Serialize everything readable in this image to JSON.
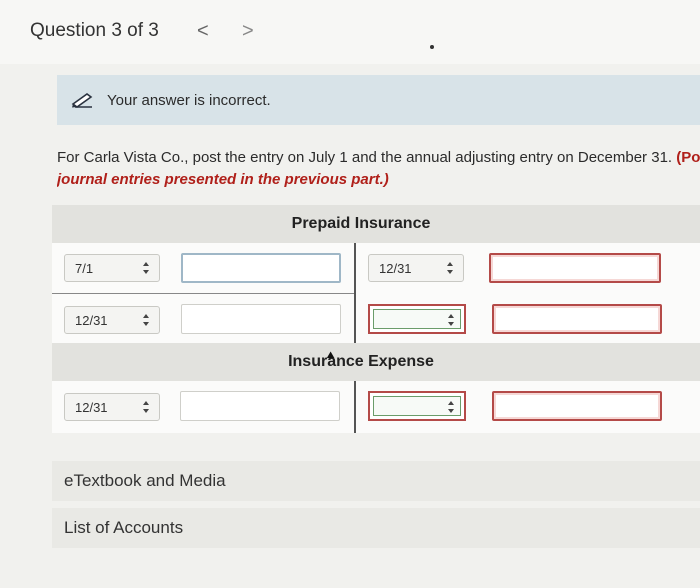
{
  "header": {
    "question": "Question 3 of 3",
    "prev": "<",
    "next": ">"
  },
  "banner": {
    "icon": "pencil-icon",
    "message": "Your answer is incorrect."
  },
  "prompt": {
    "text": "For Carla Vista Co., post the entry on July 1 and the annual adjusting entry on December 31.",
    "red_bold": "(Post e",
    "red_italic": "journal entries presented in the previous part.)"
  },
  "ledgers": {
    "prepaid": {
      "title": "Prepaid Insurance",
      "row1_left_date": "7/1",
      "row1_right_date": "12/31",
      "row2_left_date": "12/31"
    },
    "expense": {
      "title": "Insurance Expense",
      "row1_left_date": "12/31"
    }
  },
  "links": {
    "etextbook": "eTextbook and Media",
    "accounts": "List of Accounts"
  },
  "colors": {
    "error": "#b44a48",
    "banner": "#d8e3e8",
    "header_bg": "#e2e2de"
  }
}
